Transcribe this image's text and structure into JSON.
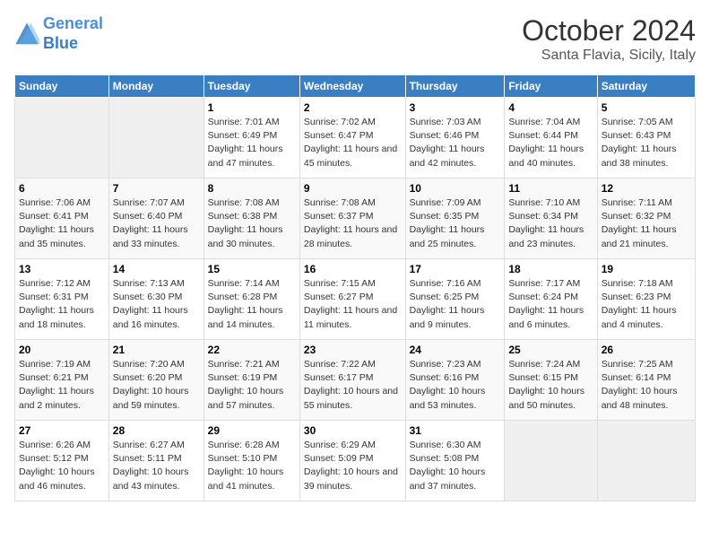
{
  "header": {
    "logo_line1": "General",
    "logo_line2": "Blue",
    "month": "October 2024",
    "location": "Santa Flavia, Sicily, Italy"
  },
  "days_of_week": [
    "Sunday",
    "Monday",
    "Tuesday",
    "Wednesday",
    "Thursday",
    "Friday",
    "Saturday"
  ],
  "weeks": [
    [
      {
        "num": "",
        "empty": true
      },
      {
        "num": "",
        "empty": true
      },
      {
        "num": "1",
        "sunrise": "7:01 AM",
        "sunset": "6:49 PM",
        "daylight": "11 hours and 47 minutes."
      },
      {
        "num": "2",
        "sunrise": "7:02 AM",
        "sunset": "6:47 PM",
        "daylight": "11 hours and 45 minutes."
      },
      {
        "num": "3",
        "sunrise": "7:03 AM",
        "sunset": "6:46 PM",
        "daylight": "11 hours and 42 minutes."
      },
      {
        "num": "4",
        "sunrise": "7:04 AM",
        "sunset": "6:44 PM",
        "daylight": "11 hours and 40 minutes."
      },
      {
        "num": "5",
        "sunrise": "7:05 AM",
        "sunset": "6:43 PM",
        "daylight": "11 hours and 38 minutes."
      }
    ],
    [
      {
        "num": "6",
        "sunrise": "7:06 AM",
        "sunset": "6:41 PM",
        "daylight": "11 hours and 35 minutes."
      },
      {
        "num": "7",
        "sunrise": "7:07 AM",
        "sunset": "6:40 PM",
        "daylight": "11 hours and 33 minutes."
      },
      {
        "num": "8",
        "sunrise": "7:08 AM",
        "sunset": "6:38 PM",
        "daylight": "11 hours and 30 minutes."
      },
      {
        "num": "9",
        "sunrise": "7:08 AM",
        "sunset": "6:37 PM",
        "daylight": "11 hours and 28 minutes."
      },
      {
        "num": "10",
        "sunrise": "7:09 AM",
        "sunset": "6:35 PM",
        "daylight": "11 hours and 25 minutes."
      },
      {
        "num": "11",
        "sunrise": "7:10 AM",
        "sunset": "6:34 PM",
        "daylight": "11 hours and 23 minutes."
      },
      {
        "num": "12",
        "sunrise": "7:11 AM",
        "sunset": "6:32 PM",
        "daylight": "11 hours and 21 minutes."
      }
    ],
    [
      {
        "num": "13",
        "sunrise": "7:12 AM",
        "sunset": "6:31 PM",
        "daylight": "11 hours and 18 minutes."
      },
      {
        "num": "14",
        "sunrise": "7:13 AM",
        "sunset": "6:30 PM",
        "daylight": "11 hours and 16 minutes."
      },
      {
        "num": "15",
        "sunrise": "7:14 AM",
        "sunset": "6:28 PM",
        "daylight": "11 hours and 14 minutes."
      },
      {
        "num": "16",
        "sunrise": "7:15 AM",
        "sunset": "6:27 PM",
        "daylight": "11 hours and 11 minutes."
      },
      {
        "num": "17",
        "sunrise": "7:16 AM",
        "sunset": "6:25 PM",
        "daylight": "11 hours and 9 minutes."
      },
      {
        "num": "18",
        "sunrise": "7:17 AM",
        "sunset": "6:24 PM",
        "daylight": "11 hours and 6 minutes."
      },
      {
        "num": "19",
        "sunrise": "7:18 AM",
        "sunset": "6:23 PM",
        "daylight": "11 hours and 4 minutes."
      }
    ],
    [
      {
        "num": "20",
        "sunrise": "7:19 AM",
        "sunset": "6:21 PM",
        "daylight": "11 hours and 2 minutes."
      },
      {
        "num": "21",
        "sunrise": "7:20 AM",
        "sunset": "6:20 PM",
        "daylight": "10 hours and 59 minutes."
      },
      {
        "num": "22",
        "sunrise": "7:21 AM",
        "sunset": "6:19 PM",
        "daylight": "10 hours and 57 minutes."
      },
      {
        "num": "23",
        "sunrise": "7:22 AM",
        "sunset": "6:17 PM",
        "daylight": "10 hours and 55 minutes."
      },
      {
        "num": "24",
        "sunrise": "7:23 AM",
        "sunset": "6:16 PM",
        "daylight": "10 hours and 53 minutes."
      },
      {
        "num": "25",
        "sunrise": "7:24 AM",
        "sunset": "6:15 PM",
        "daylight": "10 hours and 50 minutes."
      },
      {
        "num": "26",
        "sunrise": "7:25 AM",
        "sunset": "6:14 PM",
        "daylight": "10 hours and 48 minutes."
      }
    ],
    [
      {
        "num": "27",
        "sunrise": "6:26 AM",
        "sunset": "5:12 PM",
        "daylight": "10 hours and 46 minutes."
      },
      {
        "num": "28",
        "sunrise": "6:27 AM",
        "sunset": "5:11 PM",
        "daylight": "10 hours and 43 minutes."
      },
      {
        "num": "29",
        "sunrise": "6:28 AM",
        "sunset": "5:10 PM",
        "daylight": "10 hours and 41 minutes."
      },
      {
        "num": "30",
        "sunrise": "6:29 AM",
        "sunset": "5:09 PM",
        "daylight": "10 hours and 39 minutes."
      },
      {
        "num": "31",
        "sunrise": "6:30 AM",
        "sunset": "5:08 PM",
        "daylight": "10 hours and 37 minutes."
      },
      {
        "num": "",
        "empty": true
      },
      {
        "num": "",
        "empty": true
      }
    ]
  ]
}
